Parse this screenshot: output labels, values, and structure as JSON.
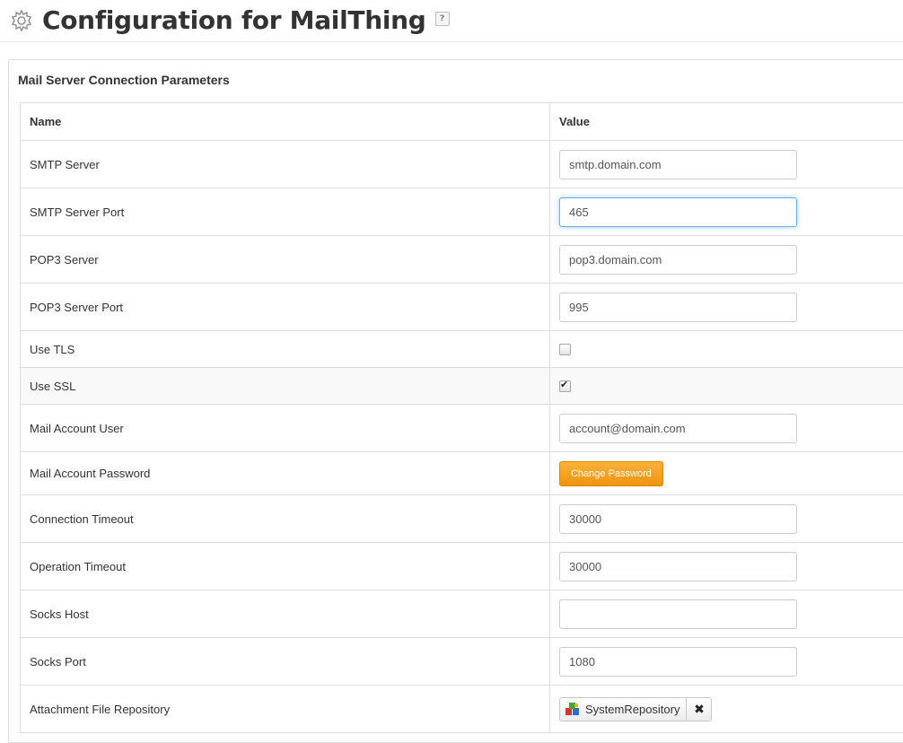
{
  "header": {
    "title": "Configuration for MailThing",
    "help_label": "?",
    "gear_icon": "gear-icon",
    "help_icon": "help-icon"
  },
  "panel": {
    "title": "Mail Server Connection Parameters",
    "columns": {
      "name": "Name",
      "value": "Value"
    }
  },
  "rows": {
    "smtp_server": {
      "label": "SMTP Server",
      "value": "smtp.domain.com"
    },
    "smtp_port": {
      "label": "SMTP Server Port",
      "value": "465"
    },
    "pop3_server": {
      "label": "POP3 Server",
      "value": "pop3.domain.com"
    },
    "pop3_port": {
      "label": "POP3 Server Port",
      "value": "995"
    },
    "use_tls": {
      "label": "Use TLS",
      "checked": false
    },
    "use_ssl": {
      "label": "Use SSL",
      "checked": true
    },
    "account_user": {
      "label": "Mail Account User",
      "value": "account@domain.com"
    },
    "account_password": {
      "label": "Mail Account Password",
      "button_label": "Change Password"
    },
    "connection_timeout": {
      "label": "Connection Timeout",
      "value": "30000"
    },
    "operation_timeout": {
      "label": "Operation Timeout",
      "value": "30000"
    },
    "socks_host": {
      "label": "Socks Host",
      "value": ""
    },
    "socks_port": {
      "label": "Socks Port",
      "value": "1080"
    },
    "attachment_repo": {
      "label": "Attachment File Repository",
      "value": "SystemRepository",
      "clear_icon": "close-icon",
      "repo_icon": "repository-icon"
    }
  },
  "colors": {
    "accent_orange": "#f0940b",
    "focus_blue": "#66afe9",
    "border": "#dddddd"
  }
}
